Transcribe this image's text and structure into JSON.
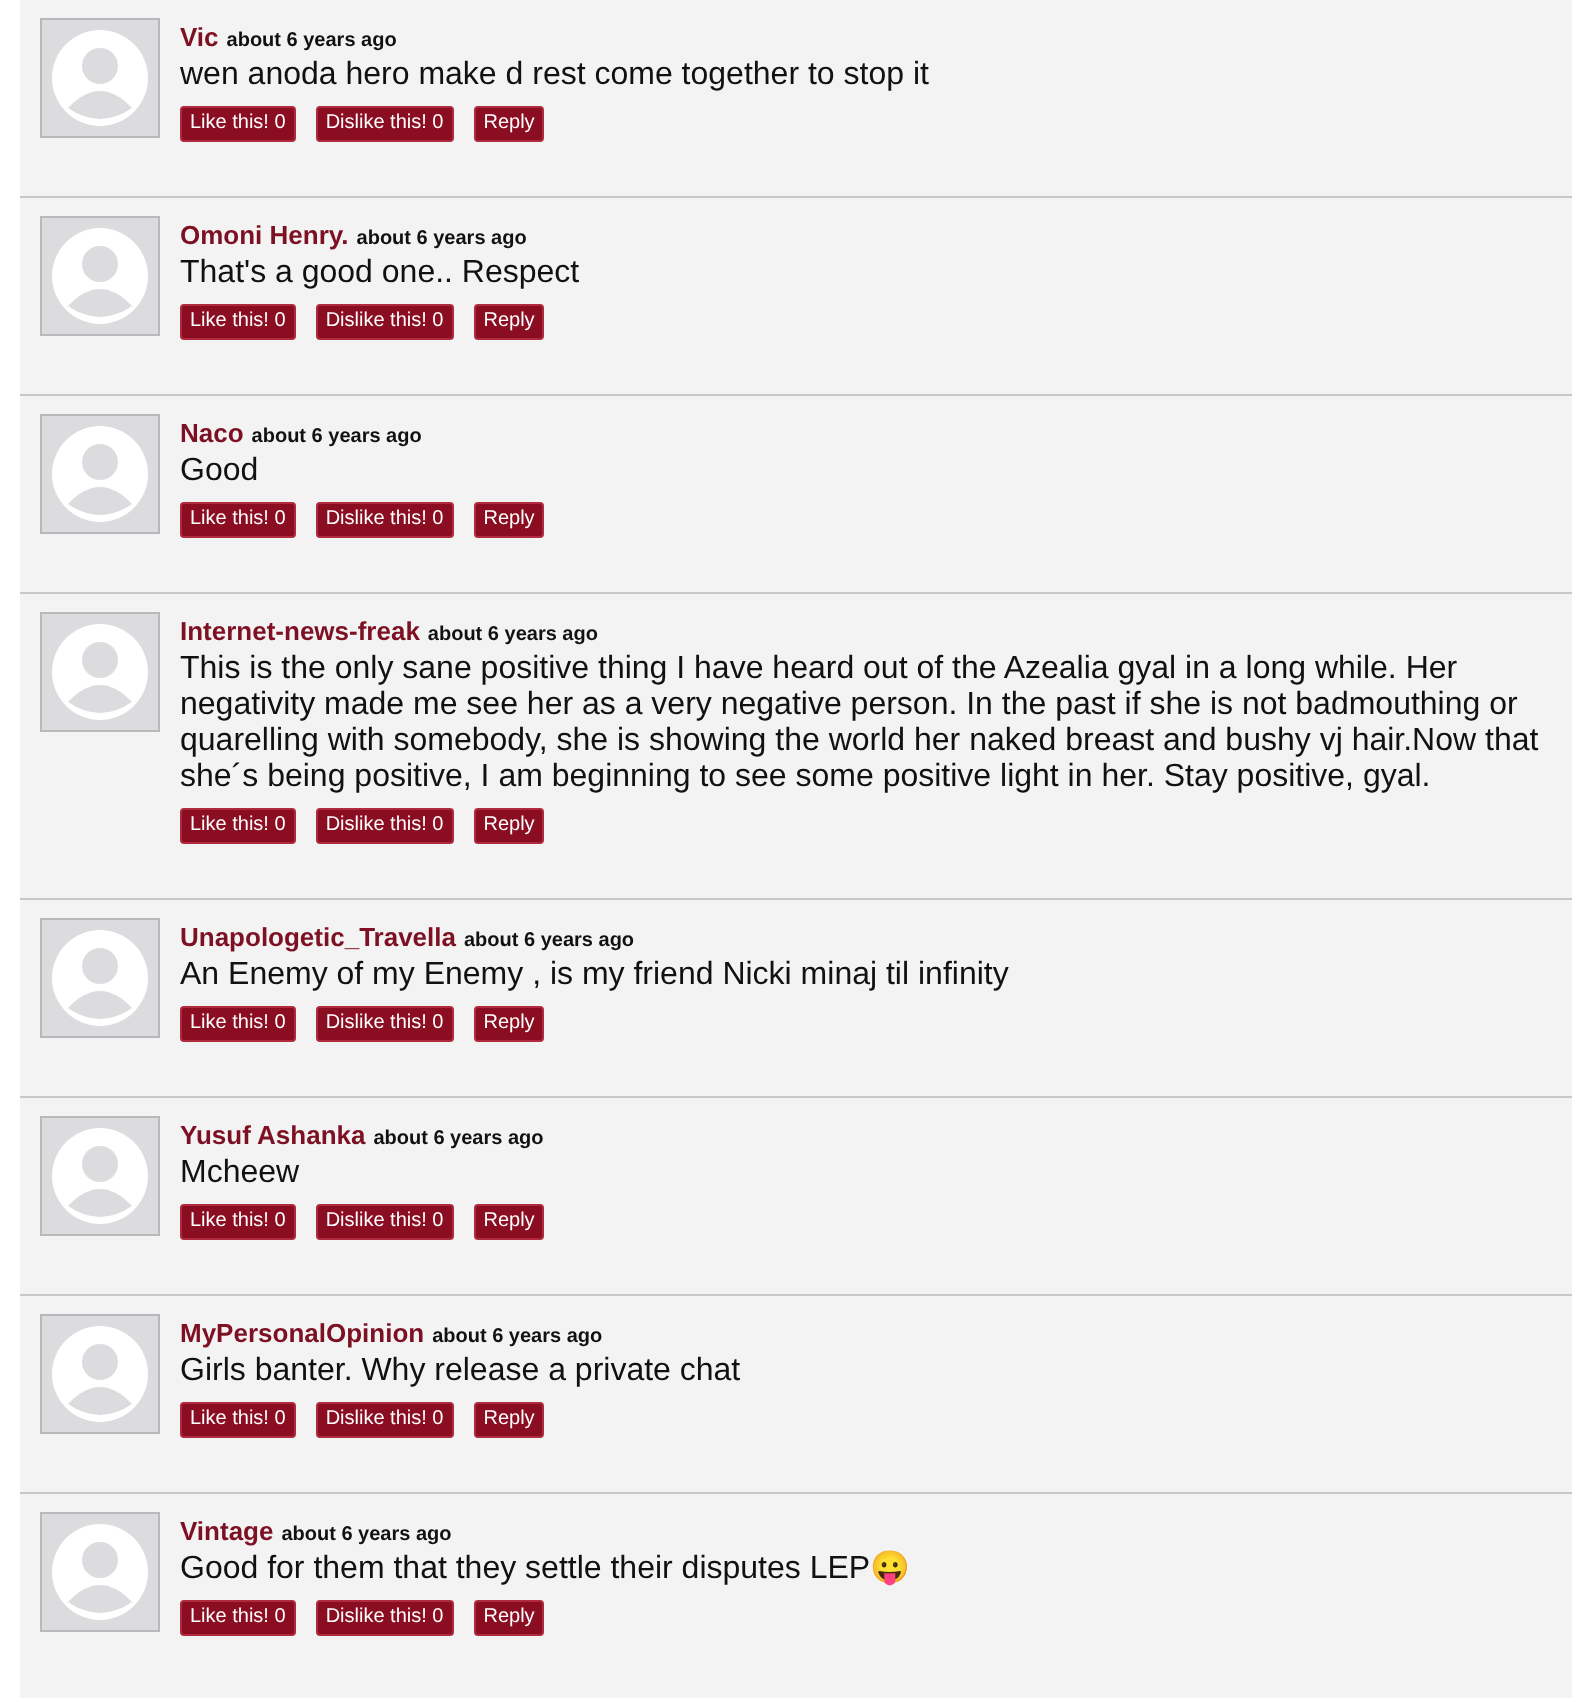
{
  "comments": [
    {
      "author": "Vic",
      "time": "about 6 years ago",
      "text": "wen anoda hero make d rest come together to stop it",
      "actions": [
        "Like this! 0",
        "Dislike this! 0",
        "Reply"
      ]
    },
    {
      "author": "Omoni Henry.",
      "time": "about 6 years ago",
      "text": "That's a good one.. Respect",
      "actions": [
        "Like this! 0",
        "Dislike this! 0",
        "Reply"
      ]
    },
    {
      "author": "Naco",
      "time": "about 6 years ago",
      "text": "Good",
      "actions": [
        "Like this! 0",
        "Dislike this! 0",
        "Reply"
      ]
    },
    {
      "author": "Internet-news-freak",
      "time": "about 6 years ago",
      "text": "This is the only sane positive thing I have heard out of the Azealia gyal in a long while. Her negativity made me see her as a very negative person. In the past if she is not badmouthing or quarelling with somebody, she is showing the world her naked breast and bushy vj hair.Now that she´s being positive, I am beginning to see some positive light in her. Stay positive, gyal.",
      "actions": [
        "Like this! 0",
        "Dislike this! 0",
        "Reply"
      ]
    },
    {
      "author": "Unapologetic_Travella",
      "time": "about 6 years ago",
      "text": "An Enemy of my Enemy , is my friend Nicki minaj til infinity",
      "actions": [
        "Like this! 0",
        "Dislike this! 0",
        "Reply"
      ]
    },
    {
      "author": "Yusuf Ashanka",
      "time": "about 6 years ago",
      "text": "Mcheew",
      "actions": [
        "Like this! 0",
        "Dislike this! 0",
        "Reply"
      ]
    },
    {
      "author": "MyPersonalOpinion",
      "time": "about 6 years ago",
      "text": "Girls banter. Why release a private chat",
      "actions": [
        "Like this! 0",
        "Dislike this! 0",
        "Reply"
      ]
    },
    {
      "author": "Vintage",
      "time": "about 6 years ago",
      "text": "Good for them that they settle their disputes LEP😛",
      "actions": [
        "Like this! 0",
        "Dislike this! 0",
        "Reply"
      ]
    }
  ]
}
